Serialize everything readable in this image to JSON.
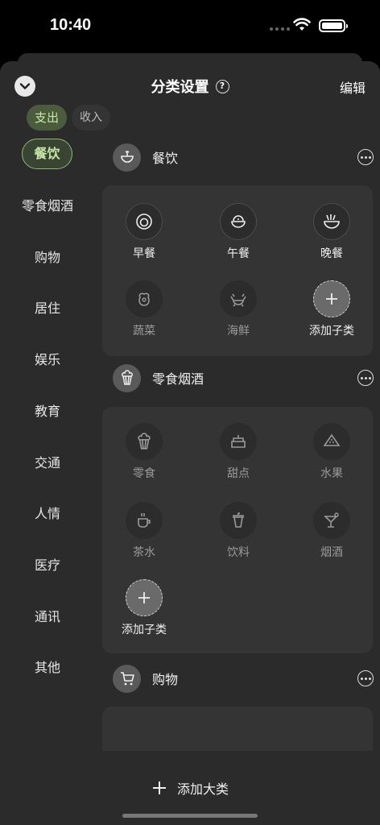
{
  "status_bar": {
    "time": "10:40"
  },
  "header": {
    "title": "分类设置",
    "help_label": "?",
    "edit_label": "编辑"
  },
  "type_tabs": [
    {
      "label": "支出",
      "active": true
    },
    {
      "label": "收入",
      "active": false
    }
  ],
  "categories": [
    {
      "label": "餐饮",
      "selected": true
    },
    {
      "label": "零食烟酒"
    },
    {
      "label": "购物"
    },
    {
      "label": "居住"
    },
    {
      "label": "娱乐"
    },
    {
      "label": "教育"
    },
    {
      "label": "交通"
    },
    {
      "label": "人情"
    },
    {
      "label": "医疗"
    },
    {
      "label": "通讯"
    },
    {
      "label": "其他"
    }
  ],
  "groups": [
    {
      "name": "餐饮",
      "icon": "bowl-icon",
      "subcategories": [
        {
          "label": "早餐",
          "icon": "breakfast-icon",
          "enabled": true
        },
        {
          "label": "午餐",
          "icon": "lunch-icon",
          "enabled": true
        },
        {
          "label": "晚餐",
          "icon": "dinner-icon",
          "enabled": true
        },
        {
          "label": "蔬菜",
          "icon": "vegetable-icon",
          "enabled": false
        },
        {
          "label": "海鲜",
          "icon": "seafood-icon",
          "enabled": false
        }
      ],
      "add_label": "添加子类"
    },
    {
      "name": "零食烟酒",
      "icon": "popcorn-icon",
      "subcategories": [
        {
          "label": "零食",
          "icon": "snack-icon",
          "enabled": false
        },
        {
          "label": "甜点",
          "icon": "dessert-icon",
          "enabled": false
        },
        {
          "label": "水果",
          "icon": "fruit-icon",
          "enabled": false
        },
        {
          "label": "茶水",
          "icon": "tea-icon",
          "enabled": false
        },
        {
          "label": "饮料",
          "icon": "drink-icon",
          "enabled": false
        },
        {
          "label": "烟酒",
          "icon": "cocktail-icon",
          "enabled": false
        }
      ],
      "add_label": "添加子类"
    },
    {
      "name": "购物",
      "icon": "cart-icon"
    }
  ],
  "bottom": {
    "add_category_label": "添加大类"
  },
  "colors": {
    "accent": "#8fb86d",
    "accent_bg": "#4b5c3d",
    "sheet_bg": "#2b2b2b",
    "card_bg": "#343434"
  }
}
